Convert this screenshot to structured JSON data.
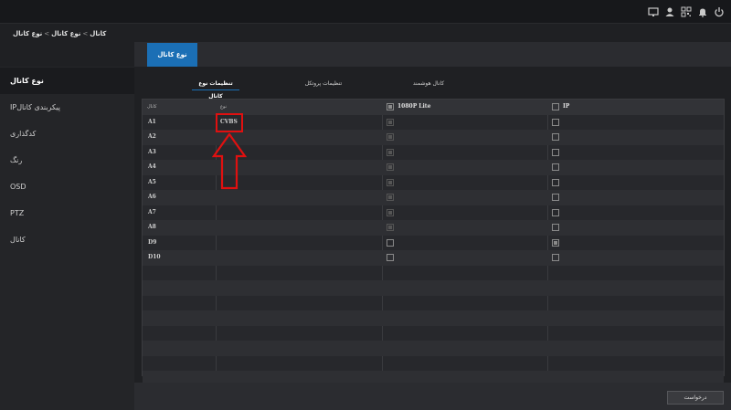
{
  "topbar": {
    "icons": [
      "monitor-icon",
      "user-icon",
      "qr-icon",
      "bell-icon",
      "power-icon"
    ]
  },
  "breadcrumb": {
    "items": [
      "کانال",
      "نوع کانال",
      "نوع کانال"
    ],
    "sep": "<"
  },
  "sidebar": {
    "items": [
      {
        "label": "نوع کانال",
        "active": true
      },
      {
        "label": "IPپیکربندی کانال",
        "active": false
      },
      {
        "label": "کدگذاری",
        "active": false
      },
      {
        "label": "رنگ",
        "active": false
      },
      {
        "label": "OSD",
        "active": false
      },
      {
        "label": "PTZ",
        "active": false
      },
      {
        "label": "کانال",
        "active": false
      }
    ]
  },
  "main": {
    "tab_label": "نوع کانال",
    "subtabs": [
      {
        "label": "تنظیمات نوع کانال",
        "active": true
      },
      {
        "label": "تنظیمات پروتکل",
        "active": false
      },
      {
        "label": "کانال هوشمند",
        "active": false
      }
    ]
  },
  "table": {
    "headers": {
      "channel": "کانال",
      "type": "نوع",
      "col3": "1080P Lite",
      "col4": "IP"
    },
    "rows": [
      {
        "name": "A1",
        "type": "CVBS",
        "lite": true,
        "ip": false
      },
      {
        "name": "A2",
        "type": "",
        "lite": true,
        "ip": false
      },
      {
        "name": "A3",
        "type": "",
        "lite": true,
        "ip": false
      },
      {
        "name": "A4",
        "type": "",
        "lite": true,
        "ip": false
      },
      {
        "name": "A5",
        "type": "",
        "lite": true,
        "ip": false
      },
      {
        "name": "A6",
        "type": "",
        "lite": true,
        "ip": false
      },
      {
        "name": "A7",
        "type": "",
        "lite": true,
        "ip": false
      },
      {
        "name": "A8",
        "type": "",
        "lite": true,
        "ip": false
      },
      {
        "name": "D9",
        "type": "",
        "lite": false,
        "ip": true
      },
      {
        "name": "D10",
        "type": "",
        "lite": false,
        "ip": false
      }
    ]
  },
  "footer": {
    "apply_label": "درخواست"
  },
  "colors": {
    "accent": "#1b6fb5",
    "annotation": "#e01010"
  }
}
